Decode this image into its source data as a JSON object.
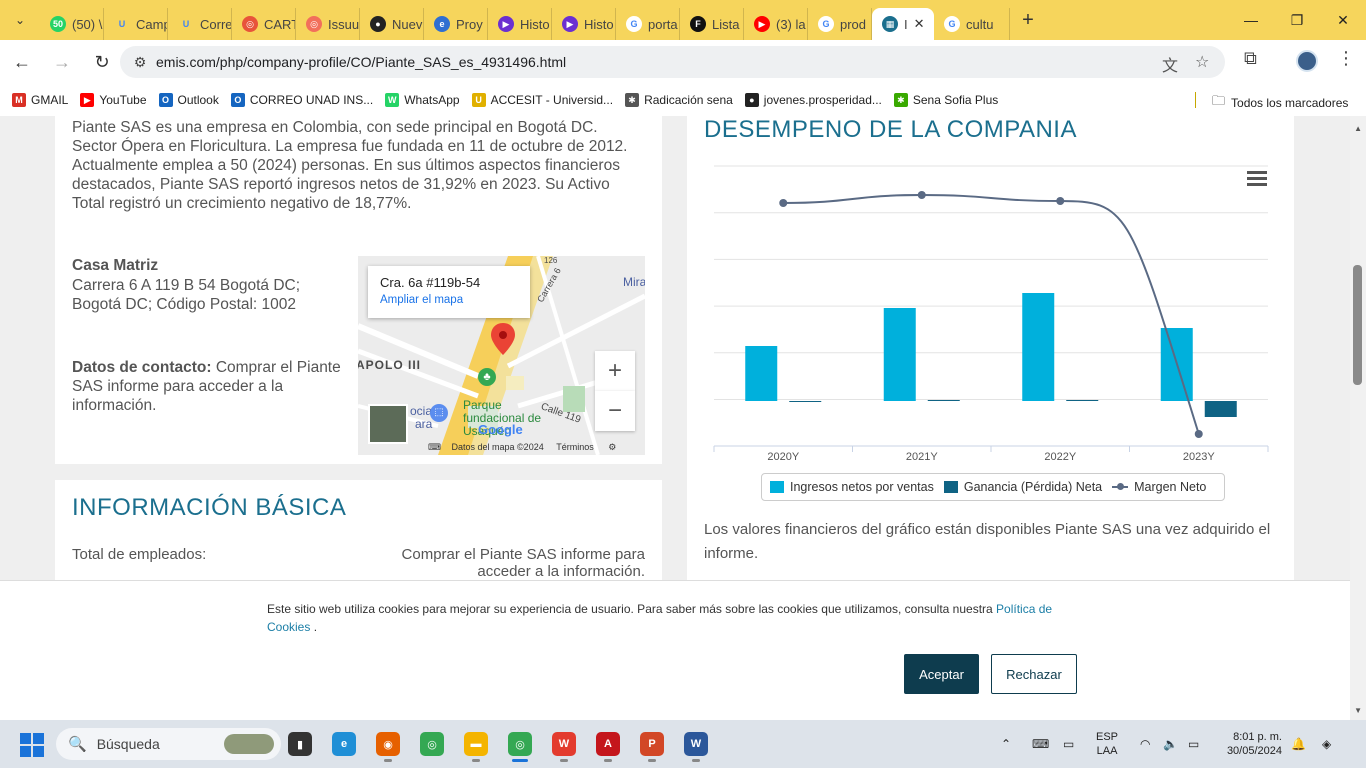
{
  "browser": {
    "tabs": [
      {
        "label": "(50) \\",
        "icon": "whatsapp-icon",
        "color": "#25d366",
        "glyph": "50"
      },
      {
        "label": "Camp",
        "icon": "unad-icon",
        "color": "#f6d55c",
        "glyph": "U"
      },
      {
        "label": "Corre",
        "icon": "unad-icon",
        "color": "#f6d55c",
        "glyph": "U"
      },
      {
        "label": "CART",
        "icon": "target-icon",
        "color": "#e8543a",
        "glyph": "◎"
      },
      {
        "label": "Issuu",
        "icon": "issuu-icon",
        "color": "#f26f5b",
        "glyph": "◎"
      },
      {
        "label": "Nuev",
        "icon": "github-icon",
        "color": "#222222",
        "glyph": "●"
      },
      {
        "label": "Proy",
        "icon": "edge-copilot-icon",
        "color": "#2f6fd1",
        "glyph": "e"
      },
      {
        "label": "Histo",
        "icon": "video-icon",
        "color": "#6b2fd1",
        "glyph": "▶"
      },
      {
        "label": "Histo",
        "icon": "video-icon",
        "color": "#6b2fd1",
        "glyph": "▶"
      },
      {
        "label": "porta",
        "icon": "google-icon",
        "color": "#ffffff",
        "glyph": "G"
      },
      {
        "label": "Lista",
        "icon": "f-icon",
        "color": "#111111",
        "glyph": "F"
      },
      {
        "label": "(3) la",
        "icon": "youtube-icon",
        "color": "#ff0000",
        "glyph": "▶"
      },
      {
        "label": "prod",
        "icon": "google-icon",
        "color": "#ffffff",
        "glyph": "G"
      },
      {
        "label": "I",
        "icon": "emis-icon",
        "color": "#1b6f8e",
        "glyph": "▦",
        "active": true
      },
      {
        "label": "cultu",
        "icon": "google-icon",
        "color": "#ffffff",
        "glyph": "G"
      }
    ],
    "url": "emis.com/php/company-profile/CO/Piante_SAS_es_4931496.html",
    "bookmarks": [
      {
        "label": "GMAIL",
        "icon": "gmail-icon",
        "color": "#d93025",
        "glyph": "M"
      },
      {
        "label": "YouTube",
        "icon": "youtube-icon",
        "color": "#ff0000",
        "glyph": "▶"
      },
      {
        "label": "Outlook",
        "icon": "outlook-icon",
        "color": "#1565c0",
        "glyph": "O"
      },
      {
        "label": "CORREO UNAD INS...",
        "icon": "outlook-icon",
        "color": "#1565c0",
        "glyph": "O"
      },
      {
        "label": "WhatsApp",
        "icon": "whatsapp-icon",
        "color": "#25d366",
        "glyph": "W"
      },
      {
        "label": "ACCESIT - Universid...",
        "icon": "unad-icon",
        "color": "#e0b000",
        "glyph": "U"
      },
      {
        "label": "Radicación sena",
        "icon": "sena-icon",
        "color": "#555555",
        "glyph": "✱"
      },
      {
        "label": "jovenes.prosperidad...",
        "icon": "prosperidad-icon",
        "color": "#222222",
        "glyph": "●"
      },
      {
        "label": "Sena Sofia Plus",
        "icon": "sena-icon",
        "color": "#39a900",
        "glyph": "✱"
      }
    ],
    "all_bookmarks_label": "Todos los marcadores"
  },
  "company": {
    "description": "Piante SAS es una empresa en Colombia, con sede principal en Bogotá DC. Sector Ópera en Floricultura. La empresa fue fundada en 11 de octubre de 2012. Actualmente emplea a 50 (2024) personas. En sus últimos aspectos financieros destacados, Piante SAS reportó ingresos netos de 31,92% en 2023. Su Activo Total registró un crecimiento negativo de 18,77%.",
    "hq_title": "Casa Matriz",
    "hq_address": "Carrera 6 A 119 B 54 Bogotá DC; Bogotá DC; Código Postal: 1002",
    "contact_label": "Datos de contacto:",
    "contact_text": " Comprar el Piante SAS informe para acceder a la información."
  },
  "map": {
    "popup_address": "Cra. 6a #119b-54",
    "popup_link": "Ampliar el mapa",
    "labels": {
      "mira": "Mira",
      "apolo": "APOLO III",
      "parque": "Parque fundacional de Usaquén",
      "calle119": "Calle 119",
      "cra6": "Carrera 6",
      "social": "ocial",
      "ara": "ara",
      "num": "126"
    },
    "footer_data": "Datos del mapa ©2024",
    "footer_terms": "Términos",
    "google_label": "Google"
  },
  "info": {
    "title": "INFORMACIÓN BÁSICA",
    "employees_label": "Total de empleados:",
    "employees_value": "Comprar el Piante SAS informe para acceder a la información."
  },
  "performance": {
    "title": "DESEMPENO DE LA COMPANIA",
    "note": "Los valores financieros del gráfico están disponibles Piante SAS una vez adquirido el informe."
  },
  "chart_data": {
    "type": "bar",
    "categories": [
      "2020Y",
      "2021Y",
      "2022Y",
      "2023Y"
    ],
    "series": [
      {
        "name": "Ingresos netos por ventas",
        "kind": "bar",
        "color": "#00b0dc",
        "values": [
          55,
          93,
          108,
          73
        ]
      },
      {
        "name": "Ganancia (Pérdida) Neta",
        "kind": "bar",
        "color": "#0f6384",
        "values": [
          0,
          1,
          1,
          -16
        ]
      },
      {
        "name": "Margen Neto",
        "kind": "line",
        "color": "#5a6a84",
        "values": [
          198,
          206,
          200,
          -33
        ]
      }
    ],
    "ylim": [
      -45,
      235
    ],
    "grid": true,
    "legend": "bottom"
  },
  "cookie": {
    "text": "Este sitio web utiliza cookies para mejorar su experiencia de usuario. Para saber más sobre las cookies que utilizamos, consulta nuestra ",
    "link": "Política de Cookies",
    "suffix": " .",
    "accept": "Aceptar",
    "reject": "Rechazar"
  },
  "taskbar": {
    "search_placeholder": "Búsqueda",
    "lang_line1": "ESP",
    "lang_line2": "LAA",
    "time": "8:01 p. m.",
    "date": "30/05/2024"
  }
}
